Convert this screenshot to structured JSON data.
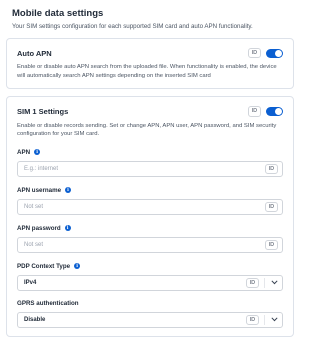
{
  "page": {
    "title": "Mobile data settings",
    "subtitle": "Your SIM settings configuration for each supported SIM card and auto APN functionality."
  },
  "auto_apn": {
    "title": "Auto APN",
    "id_badge": "ID",
    "toggle_on": true,
    "description": "Enable or disable auto APN search from the uploaded file. When functionality is enabled, the device will automatically search APN settings depending on the inserted SIM card"
  },
  "sim1": {
    "title": "SIM 1 Settings",
    "id_badge": "ID",
    "toggle_on": true,
    "description": "Enable or disable records sending. Set or change APN, APN user, APN password, and SIM security configuration for your SIM card.",
    "fields": {
      "apn": {
        "label": "APN",
        "placeholder": "E.g.: internet",
        "id_badge": "ID"
      },
      "apn_username": {
        "label": "APN username",
        "placeholder": "Not set",
        "id_badge": "ID"
      },
      "apn_password": {
        "label": "APN password",
        "placeholder": "Not set",
        "id_badge": "ID"
      },
      "pdp_context_type": {
        "label": "PDP Context Type",
        "value": "IPv4",
        "id_badge": "ID"
      },
      "gprs_authentication": {
        "label": "GPRS authentication",
        "value": "Disable",
        "id_badge": "ID"
      }
    }
  },
  "colors": {
    "accent": "#0b5fd1",
    "border": "#dde2ea"
  },
  "icons": {
    "info": "info-icon",
    "dropdown": "chevron-down-icon"
  }
}
